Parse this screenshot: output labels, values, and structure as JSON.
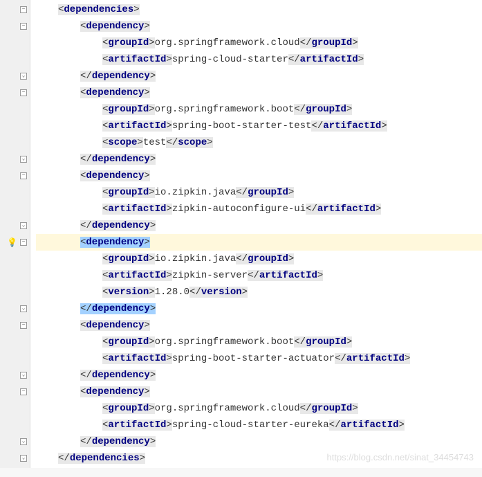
{
  "watermark": "https://blog.csdn.net/sinat_34454743",
  "tags": {
    "dependencies": "dependencies",
    "dependency": "dependency",
    "groupId": "groupId",
    "artifactId": "artifactId",
    "scope": "scope",
    "version": "version"
  },
  "deps": [
    {
      "groupId": "org.springframework.cloud",
      "artifactId": "spring-cloud-starter"
    },
    {
      "groupId": "org.springframework.boot",
      "artifactId": "spring-boot-starter-test",
      "scope": "test"
    },
    {
      "groupId": "io.zipkin.java",
      "artifactId": "zipkin-autoconfigure-ui"
    },
    {
      "groupId": "io.zipkin.java",
      "artifactId": "zipkin-server",
      "version": "1.28.0",
      "selected": true
    },
    {
      "groupId": "org.springframework.boot",
      "artifactId": "spring-boot-starter-actuator"
    },
    {
      "groupId": "org.springframework.cloud",
      "artifactId": "spring-cloud-starter-eureka"
    }
  ],
  "gutter": {
    "hasBulb": true,
    "bulbLine": 15
  }
}
